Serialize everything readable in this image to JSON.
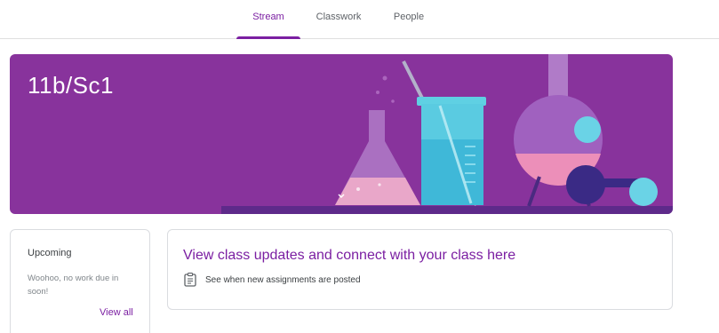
{
  "nav": {
    "tabs": [
      {
        "label": "Stream",
        "active": true
      },
      {
        "label": "Classwork",
        "active": false
      },
      {
        "label": "People",
        "active": false
      }
    ],
    "accent_color": "#7b1fa2"
  },
  "banner": {
    "title": "11b/Sc1",
    "background_color": "#88339c",
    "illustration": "science-flasks-beaker"
  },
  "upcoming": {
    "title": "Upcoming",
    "message": "Woohoo, no work due in soon!",
    "view_all_label": "View all"
  },
  "updates": {
    "title": "View class updates and connect with your class here",
    "item_text": "See when new assignments are posted",
    "item_icon": "clipboard-icon"
  }
}
